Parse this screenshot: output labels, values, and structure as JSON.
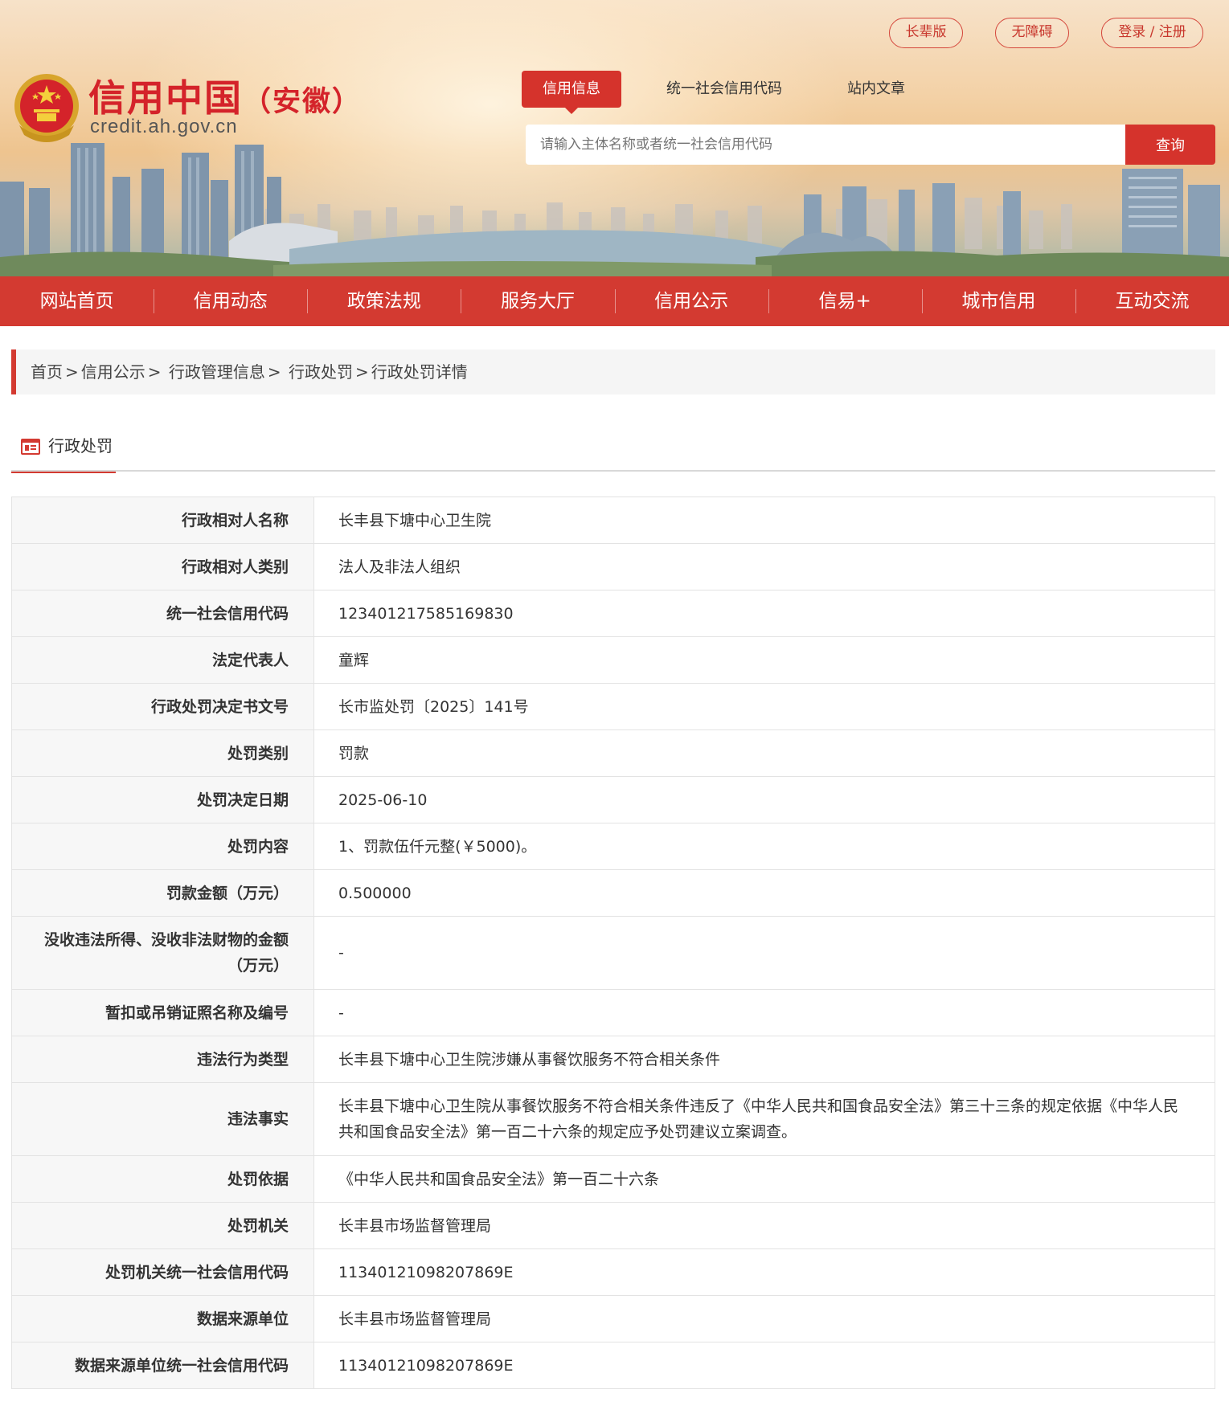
{
  "header": {
    "site_title": "信用中国",
    "site_province": "（安徽）",
    "site_domain": "credit.ah.gov.cn",
    "top_links": {
      "elder": "长辈版",
      "accessibility": "无障碍",
      "login": "登录 / 注册"
    },
    "search_tabs": [
      "信用信息",
      "统一社会信用代码",
      "站内文章"
    ],
    "search": {
      "placeholder": "请输入主体名称或者统一社会信用代码",
      "button": "查询"
    }
  },
  "nav": [
    "网站首页",
    "信用动态",
    "政策法规",
    "服务大厅",
    "信用公示",
    "信易+",
    "城市信用",
    "互动交流"
  ],
  "breadcrumb": [
    "首页",
    "信用公示",
    "行政管理信息",
    "行政处罚",
    "行政处罚详情"
  ],
  "section": {
    "title": "行政处罚"
  },
  "details": [
    {
      "label": "行政相对人名称",
      "value": "长丰县下塘中心卫生院"
    },
    {
      "label": "行政相对人类别",
      "value": "法人及非法人组织"
    },
    {
      "label": "统一社会信用代码",
      "value": "123401217585169830"
    },
    {
      "label": "法定代表人",
      "value": "童辉"
    },
    {
      "label": "行政处罚决定书文号",
      "value": "长市监处罚〔2025〕141号"
    },
    {
      "label": "处罚类别",
      "value": "罚款"
    },
    {
      "label": "处罚决定日期",
      "value": "2025-06-10"
    },
    {
      "label": "处罚内容",
      "value": "1、罚款伍仟元整(￥5000)。"
    },
    {
      "label": "罚款金额（万元）",
      "value": "0.500000"
    },
    {
      "label": "没收违法所得、没收非法财物的金额（万元）",
      "value": "-"
    },
    {
      "label": "暂扣或吊销证照名称及编号",
      "value": "-"
    },
    {
      "label": "违法行为类型",
      "value": "长丰县下塘中心卫生院涉嫌从事餐饮服务不符合相关条件"
    },
    {
      "label": "违法事实",
      "value": "长丰县下塘中心卫生院从事餐饮服务不符合相关条件违反了《中华人民共和国食品安全法》第三十三条的规定依据《中华人民共和国食品安全法》第一百二十六条的规定应予处罚建议立案调查。"
    },
    {
      "label": "处罚依据",
      "value": "《中华人民共和国食品安全法》第一百二十六条"
    },
    {
      "label": "处罚机关",
      "value": "长丰县市场监督管理局"
    },
    {
      "label": "处罚机关统一社会信用代码",
      "value": "11340121098207869E"
    },
    {
      "label": "数据来源单位",
      "value": "长丰县市场监督管理局"
    },
    {
      "label": "数据来源单位统一社会信用代码",
      "value": "11340121098207869E"
    }
  ],
  "colors": {
    "brand_red": "#d33a31",
    "table_key_bg": "#f7f7f7",
    "border": "#e3e3e3"
  },
  "icons": [
    "national-emblem-icon",
    "document-list-icon"
  ]
}
